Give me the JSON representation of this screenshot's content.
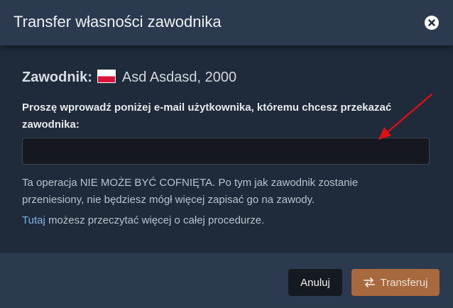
{
  "modal": {
    "title": "Transfer własności zawodnika",
    "close_icon": "close-icon"
  },
  "body": {
    "player_label": "Zawodnik:",
    "player_flag": "poland-flag-icon",
    "player_name": "Asd Asdasd, 2000",
    "prompt": "Proszę wprowadź poniżej e-mail użytkownika, któremu chcesz przekazać zawodnika:",
    "email_value": "",
    "warning": "Ta operacja NIE MOŻE BYĆ COFNIĘTA. Po tym jak zawodnik zostanie przeniesiony, nie będziesz mógł więcej zapisać go na zawody.",
    "link_text": "Tutaj",
    "link_rest": " możesz przeczytać więcej o całej procedurze."
  },
  "footer": {
    "cancel_label": "Anuluj",
    "transfer_label": "Transferuj",
    "transfer_icon": "exchange-arrows-icon"
  },
  "colors": {
    "header_bg": "#2b3a4e",
    "body_bg": "#1f2b3b",
    "transfer_button": "#a8693f",
    "cancel_button": "#151a20",
    "link": "#7fb2e5",
    "annotation_arrow": "#e01010"
  }
}
